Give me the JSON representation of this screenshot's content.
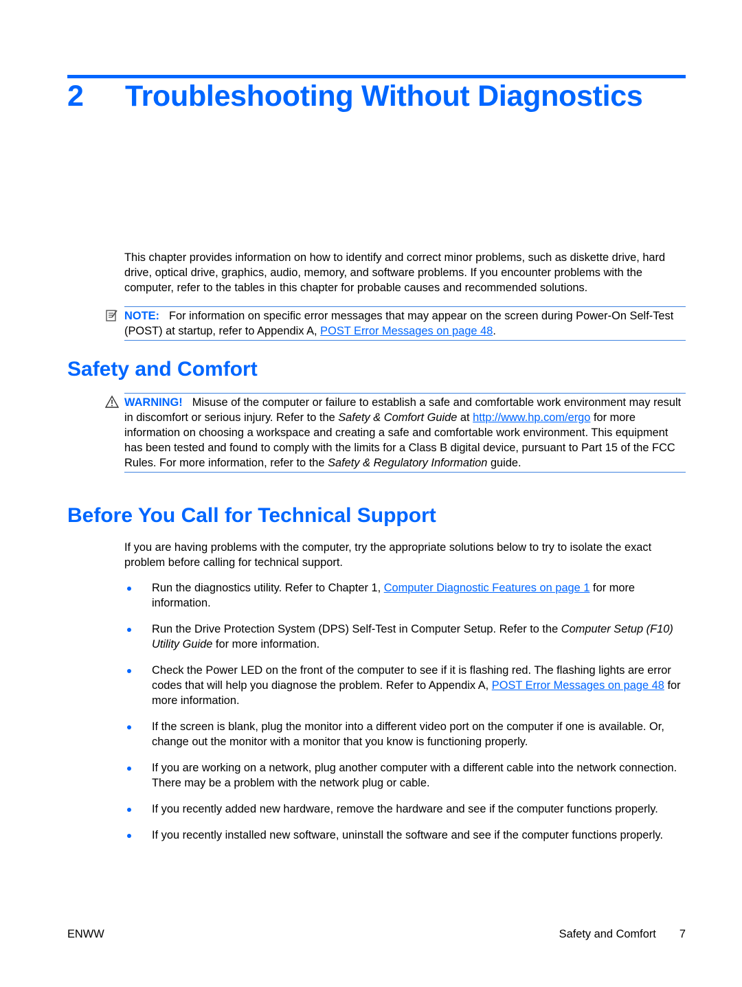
{
  "chapter": {
    "number": "2",
    "title": "Troubleshooting Without Diagnostics"
  },
  "intro": "This chapter provides information on how to identify and correct minor problems, such as diskette drive, hard drive, optical drive, graphics, audio, memory, and software problems. If you encounter problems with the computer, refer to the tables in this chapter for probable causes and recommended solutions.",
  "note": {
    "icon": "note-icon",
    "label": "NOTE:",
    "text_before": "For information on specific error messages that may appear on the screen during Power-On Self-Test (POST) at startup, refer to Appendix A, ",
    "link": "POST Error Messages on page 48",
    "text_after": "."
  },
  "safety": {
    "heading": "Safety and Comfort",
    "warning": {
      "icon": "warning-triangle-icon",
      "label": "WARNING!",
      "t1": "Misuse of the computer or failure to establish a safe and comfortable work environment may result in discomfort or serious injury. Refer to the ",
      "i1": "Safety & Comfort Guide",
      "t2": " at ",
      "link": "http://www.hp.com/ergo",
      "t3": " for more information on choosing a workspace and creating a safe and comfortable work environment. This equipment has been tested and found to comply with the limits for a Class B digital device, pursuant to Part 15 of the FCC Rules. For more information, refer to the ",
      "i2": "Safety & Regulatory Information",
      "t4": " guide."
    }
  },
  "support": {
    "heading": "Before You Call for Technical Support",
    "intro": "If you are having problems with the computer, try the appropriate solutions below to try to isolate the exact problem before calling for technical support.",
    "bullets": [
      {
        "a": "Run the diagnostics utility. Refer to Chapter 1, ",
        "link": "Computer Diagnostic Features on page 1",
        "b": " for more information."
      },
      {
        "a": "Run the Drive Protection System (DPS) Self-Test in Computer Setup. Refer to the ",
        "italic": "Computer Setup (F10) Utility Guide",
        "b": " for more information."
      },
      {
        "a": "Check the Power LED on the front of the computer to see if it is flashing red. The flashing lights are error codes that will help you diagnose the problem. Refer to Appendix A, ",
        "link": "POST Error Messages on page 48",
        "b": " for more information."
      },
      {
        "a": "If the screen is blank, plug the monitor into a different video port on the computer if one is available. Or, change out the monitor with a monitor that you know is functioning properly."
      },
      {
        "a": "If you are working on a network, plug another computer with a different cable into the network connection. There may be a problem with the network plug or cable."
      },
      {
        "a": "If you recently added new hardware, remove the hardware and see if the computer functions properly."
      },
      {
        "a": "If you recently installed new software, uninstall the software and see if the computer functions properly."
      }
    ]
  },
  "footer": {
    "left": "ENWW",
    "section": "Safety and Comfort",
    "page": "7"
  }
}
